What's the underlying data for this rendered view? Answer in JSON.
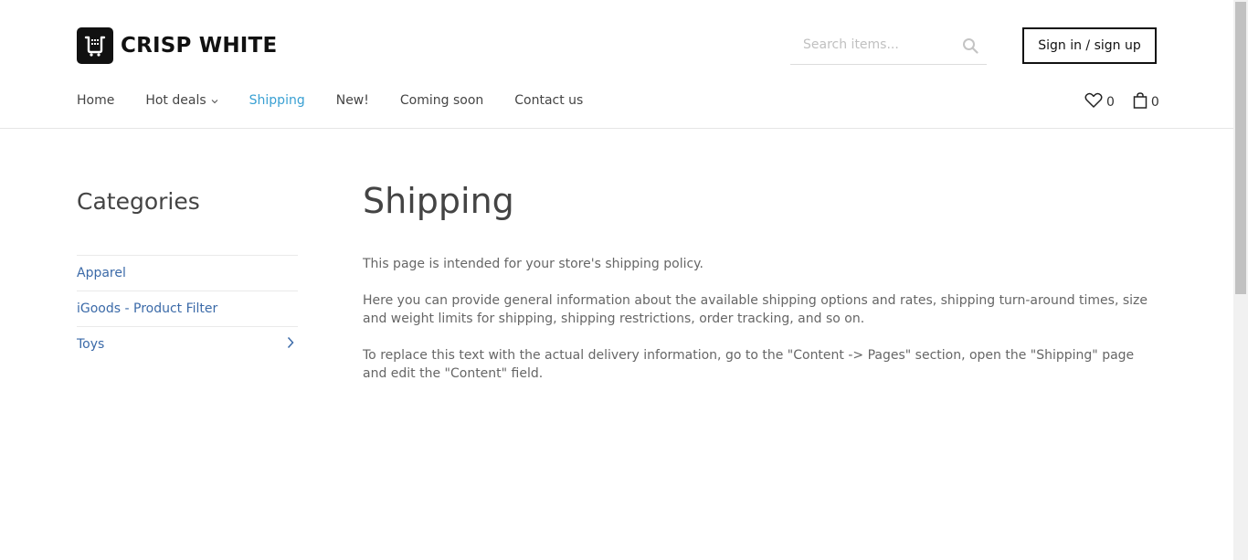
{
  "header": {
    "logo_text": "CRISP WHITE",
    "search_placeholder": "Search items...",
    "signin_label": "Sign in / sign up"
  },
  "nav": {
    "items": [
      {
        "label": "Home"
      },
      {
        "label": "Hot deals"
      },
      {
        "label": "Shipping"
      },
      {
        "label": "New!"
      },
      {
        "label": "Coming soon"
      },
      {
        "label": "Contact us"
      }
    ]
  },
  "counters": {
    "wishlist": "0",
    "cart": "0"
  },
  "sidebar": {
    "title": "Categories",
    "items": [
      {
        "label": "Apparel"
      },
      {
        "label": "iGoods - Product Filter"
      },
      {
        "label": "Toys"
      }
    ]
  },
  "main": {
    "title": "Shipping",
    "paragraphs": [
      "This page is intended for your store's shipping policy.",
      "Here you can provide general information about the available shipping options and rates, shipping turn-around times, size and weight limits for shipping, shipping restrictions, order tracking, and so on.",
      "To replace this text with the actual delivery information, go to the \"Content -> Pages\" section, open the \"Shipping\" page and edit the \"Content\" field."
    ]
  },
  "colors": {
    "accent": "#39a0d3",
    "link": "#3b6aa8",
    "text": "#444444",
    "logo_bg": "#111111"
  },
  "icons": [
    "logo-cart-icon",
    "search-icon",
    "chevron-down-icon",
    "heart-icon",
    "shopping-bag-icon",
    "chevron-right-icon"
  ]
}
